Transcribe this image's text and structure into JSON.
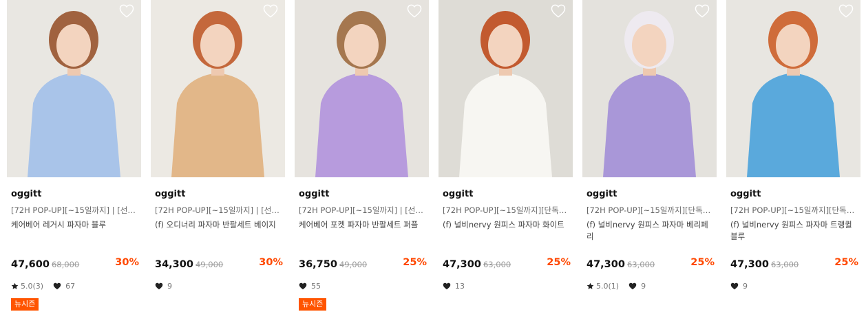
{
  "products": [
    {
      "brand": "oggitt",
      "tag": "[72H POP-UP][~15일까지] | [선물포...",
      "name": "케어베어 레거시 파자마 블루",
      "price": "47,600",
      "original_price": "68,000",
      "discount": "30%",
      "rating": "5.0(3)",
      "likes": "67",
      "badge": "뉴시즌",
      "image_colors": {
        "background": "#e9e7e2",
        "outfit": "#a9c4e9",
        "hair": "#a0623f"
      }
    },
    {
      "brand": "oggitt",
      "tag": "[72H POP-UP][~15일까지] | [선물포...",
      "name": "(f) 오디너리 파자마 반팔세트 베이지",
      "price": "34,300",
      "original_price": "49,000",
      "discount": "30%",
      "likes": "9",
      "image_colors": {
        "background": "#ece9e3",
        "outfit": "#e2b789",
        "hair": "#c4683c"
      }
    },
    {
      "brand": "oggitt",
      "tag": "[72H POP-UP][~15일까지] | [선물포...",
      "name": "케어베어 포켓 파자마 반팔세트 퍼플",
      "price": "36,750",
      "original_price": "49,000",
      "discount": "25%",
      "likes": "55",
      "badge": "뉴시즌",
      "image_colors": {
        "background": "#e6e3de",
        "outfit": "#b79bdd",
        "hair": "#a5774f"
      }
    },
    {
      "brand": "oggitt",
      "tag": "[72H POP-UP][~15일까지][단독세일...",
      "name": "(f) 널비nervy 원피스 파자마 화이트",
      "price": "47,300",
      "original_price": "63,000",
      "discount": "25%",
      "likes": "13",
      "image_colors": {
        "background": "#dedcd6",
        "outfit": "#f7f6f2",
        "hair": "#c25a2f"
      }
    },
    {
      "brand": "oggitt",
      "tag": "[72H POP-UP][~15일까지][단독세일...",
      "name": "(f) 널비nervy 원피스 파자마 베리페리",
      "price": "47,300",
      "original_price": "63,000",
      "discount": "25%",
      "rating": "5.0(1)",
      "likes": "9",
      "image_colors": {
        "background": "#e4e2dd",
        "outfit": "#a997d8",
        "hair": "#eeeaf0"
      }
    },
    {
      "brand": "oggitt",
      "tag": "[72H POP-UP][~15일까지][단독세일...",
      "name": "(f) 널비nervy 원피스 파자마 트랭퀼 블루",
      "price": "47,300",
      "original_price": "63,000",
      "discount": "25%",
      "likes": "9",
      "image_colors": {
        "background": "#e8e6e1",
        "outfit": "#5aa9dc",
        "hair": "#cf6c3a"
      }
    }
  ],
  "icons": {
    "wishlist": "heart-outline-icon",
    "rating": "star-icon",
    "likes": "heart-filled-icon"
  },
  "colors": {
    "discount": "#ff4800",
    "badge": "#ff5400"
  }
}
